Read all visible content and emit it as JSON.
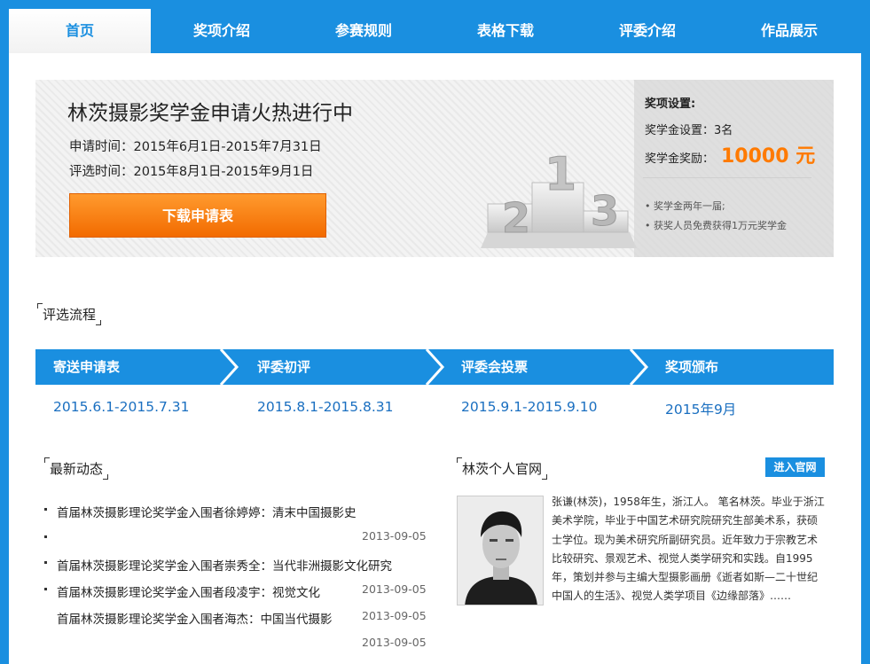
{
  "nav": {
    "items": [
      "首页",
      "奖项介绍",
      "参赛规则",
      "表格下载",
      "评委介绍",
      "作品展示"
    ]
  },
  "banner": {
    "title": "林茨摄影奖学金申请火热进行中",
    "apply_time": "申请时间：2015年6月1日-2015年7月31日",
    "review_time": "评选时间：2015年8月1日-2015年9月1日",
    "download_label": "下载申请表"
  },
  "award": {
    "title": "奖项设置:",
    "count": "奖学金设置：3名",
    "amount_label": "奖学金奖励：",
    "amount": "10000 元",
    "notes": [
      "奖学金两年一届;",
      "获奖人员免费获得1万元奖学金"
    ]
  },
  "process": {
    "title": "评选流程",
    "steps": [
      {
        "label": "寄送申请表",
        "date": "2015.6.1-2015.7.31"
      },
      {
        "label": "评委初评",
        "date": "2015.8.1-2015.8.31"
      },
      {
        "label": "评委会投票",
        "date": "2015.9.1-2015.9.10"
      },
      {
        "label": "奖项颁布",
        "date": "2015年9月"
      }
    ]
  },
  "news": {
    "title": "最新动态",
    "items": [
      {
        "text": "首届林茨摄影理论奖学金入围者徐婷婷：清末中国摄影史",
        "bullet": true
      },
      {
        "text": "",
        "bullet": true
      },
      {
        "text": "首届林茨摄影理论奖学金入围者崇秀全：当代非洲摄影文化研究",
        "bullet": true
      },
      {
        "text": "首届林茨摄影理论奖学金入围者段凌宇：视觉文化",
        "bullet": true
      },
      {
        "text": "首届林茨摄影理论奖学金入围者海杰：中国当代摄影",
        "bullet": false
      }
    ],
    "dates": [
      "2013-09-05",
      "2013-09-05",
      "2013-09-05",
      "2013-09-05"
    ]
  },
  "profile": {
    "title": "林茨个人官网",
    "enter_label": "进入官网",
    "bio": "张谦(林茨)，1958年生，浙江人。 笔名林茨。毕业于浙江美术学院，毕业于中国艺术研究院研究生部美术系，获硕士学位。现为美术研究所副研究员。近年致力于宗教艺术比较研究、景观艺术、视觉人类学研究和实践。自1995年，策划并参与主编大型摄影画册《逝者如斯—二十世纪中国人的生活》、视觉人类学项目《边缘部落》……"
  },
  "colors": {
    "brand_blue": "#1a8fe0",
    "accent_orange": "#ff7a00"
  }
}
